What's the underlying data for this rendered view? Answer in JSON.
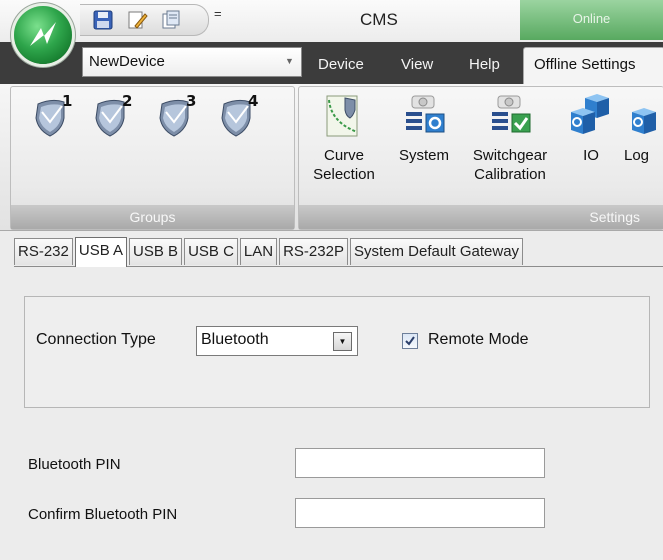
{
  "app": {
    "title": "CMS",
    "status": "Online",
    "quick_access": [
      "save-icon",
      "edit-icon",
      "file-icon",
      "customize-icon"
    ],
    "customize_glyph": "="
  },
  "device": {
    "selected": "NewDevice"
  },
  "ribbon_tabs": [
    "Device",
    "View",
    "Help",
    "Offline Settings"
  ],
  "groups": {
    "label": "Groups",
    "items": [
      {
        "number": "1"
      },
      {
        "number": "2"
      },
      {
        "number": "3"
      },
      {
        "number": "4"
      }
    ]
  },
  "settings": {
    "label": "Settings",
    "buttons": [
      {
        "line1": "Curve",
        "line2": "Selection"
      },
      {
        "line1": "System",
        "line2": ""
      },
      {
        "line1": "Switchgear",
        "line2": "Calibration"
      },
      {
        "line1": "IO",
        "line2": ""
      },
      {
        "line1": "Log",
        "line2": ""
      }
    ]
  },
  "content_tabs": [
    "RS-232",
    "USB A",
    "USB B",
    "USB C",
    "LAN",
    "RS-232P",
    "System Default Gateway"
  ],
  "active_tab": "USB A",
  "form": {
    "connection_type_label": "Connection Type",
    "connection_type_value": "Bluetooth",
    "remote_mode_label": "Remote Mode",
    "remote_mode_checked": true,
    "pin_label": "Bluetooth PIN",
    "pin_value": "",
    "confirm_pin_label": "Confirm Bluetooth PIN",
    "confirm_pin_value": ""
  },
  "colors": {
    "tab_row": "#3c3c3c",
    "status_green": "#58a960",
    "orb_green": "#2ea54b"
  }
}
